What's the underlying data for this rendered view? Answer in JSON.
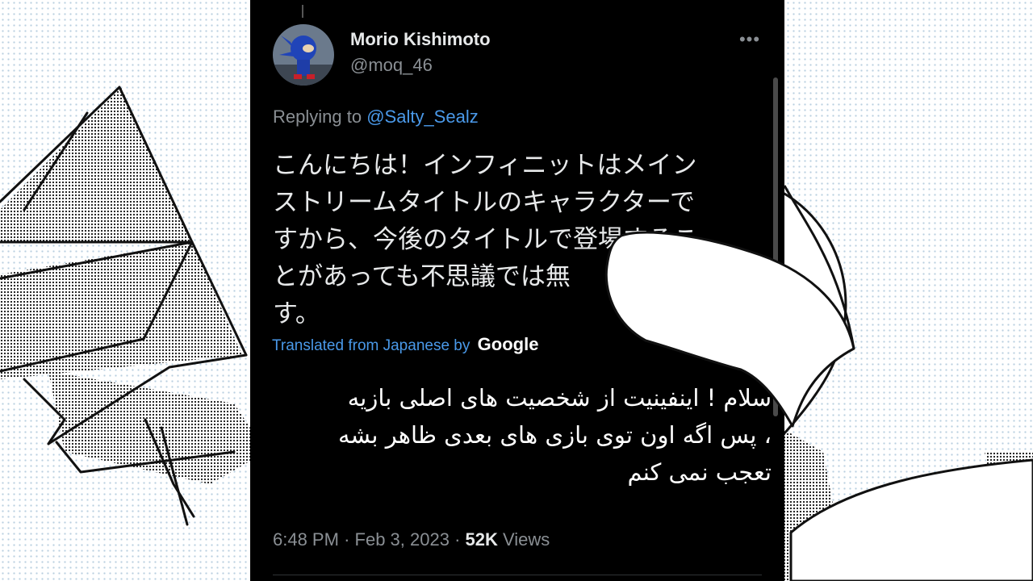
{
  "tweet": {
    "display_name": "Morio Kishimoto",
    "handle": "@moq_46",
    "replying_prefix": "Replying to",
    "replying_to": "@Salty_Sealz",
    "text_lines": [
      "こんにちは！インフィニットはメイン",
      "ストリームタイトルのキャラクターで",
      "すから、今後のタイトルで登場するこ",
      "とがあっても不思議では無",
      "す。"
    ],
    "translated_label": "Translated from Japanese by",
    "translator": "Google",
    "time": "6:48 PM",
    "separator": "·",
    "date": "Feb 3, 2023",
    "views_count": "52K",
    "views_label": "Views"
  },
  "overlay_translation": {
    "lines": [
      "سلام ! اینفینیت از شخصیت های اصلی بازیه",
      "، پس اگه اون توی بازی های بعدی ظاهر بشه",
      "تعجب نمی کنم"
    ]
  },
  "colors": {
    "background": "#000000",
    "link": "#4a99e9",
    "muted": "#8a8f94",
    "primary_text": "#e7e9ea"
  },
  "icons": {
    "more": "more-horizontal-icon"
  }
}
